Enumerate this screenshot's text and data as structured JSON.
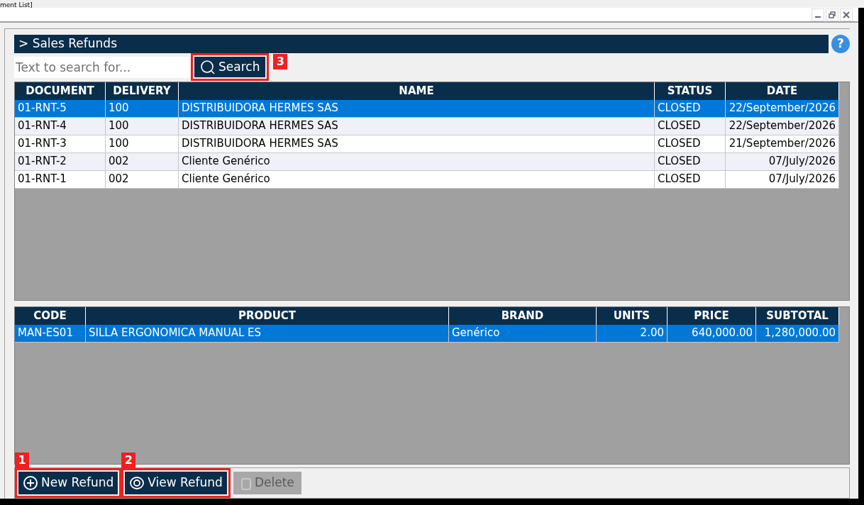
{
  "window": {
    "title": "ment List]"
  },
  "panel": {
    "title": "> Sales Refunds",
    "help": "?"
  },
  "search": {
    "placeholder": "Text to search for...",
    "button": {
      "label": "Search",
      "callout": "3"
    }
  },
  "documents": {
    "columns": [
      "DOCUMENT",
      "DELIVERY",
      "NAME",
      "STATUS",
      "DATE"
    ],
    "rows": [
      {
        "selected": true,
        "cells": [
          "01-RNT-5",
          "100",
          "DISTRIBUIDORA HERMES SAS",
          "CLOSED",
          "22/September/2026"
        ]
      },
      {
        "selected": false,
        "cells": [
          "01-RNT-4",
          "100",
          "DISTRIBUIDORA HERMES SAS",
          "CLOSED",
          "22/September/2026"
        ]
      },
      {
        "selected": false,
        "cells": [
          "01-RNT-3",
          "100",
          "DISTRIBUIDORA HERMES SAS",
          "CLOSED",
          "21/September/2026"
        ]
      },
      {
        "selected": false,
        "cells": [
          "01-RNT-2",
          "002",
          "Cliente Genérico",
          "CLOSED",
          "07/July/2026"
        ]
      },
      {
        "selected": false,
        "cells": [
          "01-RNT-1",
          "002",
          "Cliente Genérico",
          "CLOSED",
          "07/July/2026"
        ]
      }
    ]
  },
  "items": {
    "columns": [
      "CODE",
      "PRODUCT",
      "BRAND",
      "UNITS",
      "PRICE",
      "SUBTOTAL"
    ],
    "rows": [
      {
        "selected": true,
        "cells": [
          "MAN-ES01",
          "SILLA ERGONOMICA MANUAL ES",
          "Genérico",
          "2.00",
          "640,000.00",
          "1,280,000.00"
        ]
      }
    ]
  },
  "actions": [
    {
      "kind": "new",
      "label": "New Refund",
      "disabled": false,
      "callout": "1"
    },
    {
      "kind": "view",
      "label": "View Refund",
      "disabled": false,
      "callout": "2"
    },
    {
      "kind": "delete",
      "label": "Delete",
      "disabled": true
    }
  ]
}
